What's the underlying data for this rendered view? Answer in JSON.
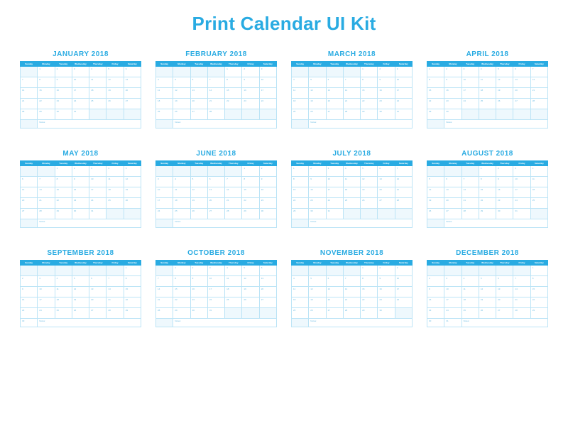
{
  "title": "Print Calendar UI Kit",
  "year": 2018,
  "dow": [
    "Sunday",
    "Monday",
    "Tuesday",
    "Wednesday",
    "Thursday",
    "Friday",
    "Saturday"
  ],
  "notes_label": "Notes:",
  "months": [
    {
      "name": "JANUARY 2018",
      "start": 1,
      "days": 31
    },
    {
      "name": "FEBRUARY 2018",
      "start": 4,
      "days": 28
    },
    {
      "name": "MARCH 2018",
      "start": 4,
      "days": 31
    },
    {
      "name": "APRIL 2018",
      "start": 0,
      "days": 30
    },
    {
      "name": "MAY 2018",
      "start": 2,
      "days": 31
    },
    {
      "name": "JUNE 2018",
      "start": 5,
      "days": 30
    },
    {
      "name": "JULY 2018",
      "start": 0,
      "days": 31
    },
    {
      "name": "AUGUST 2018",
      "start": 3,
      "days": 31
    },
    {
      "name": "SEPTEMBER 2018",
      "start": 6,
      "days": 30
    },
    {
      "name": "OCTOBER 2018",
      "start": 1,
      "days": 31
    },
    {
      "name": "NOVEMBER 2018",
      "start": 4,
      "days": 30
    },
    {
      "name": "DECEMBER 2018",
      "start": 6,
      "days": 31
    }
  ]
}
